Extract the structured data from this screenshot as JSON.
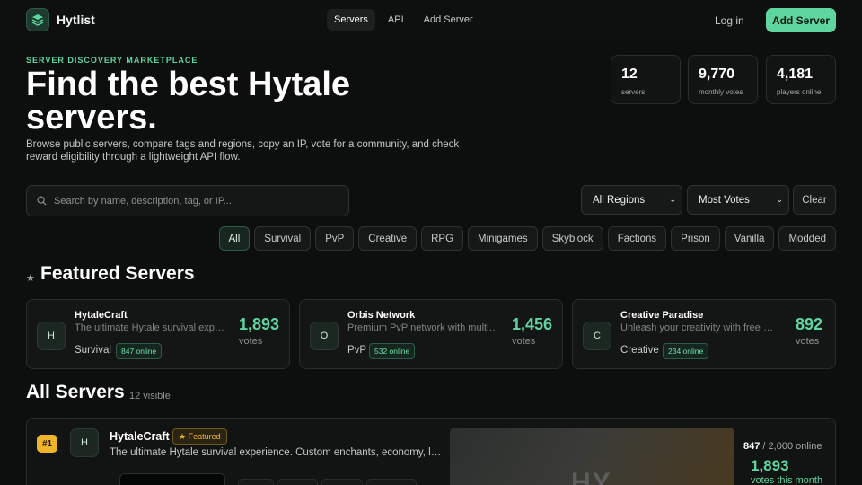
{
  "nav": {
    "brand": "Hytlist",
    "links": [
      "Servers",
      "API",
      "Add Server"
    ],
    "login": "Log in",
    "cta": "Add Server"
  },
  "hero": {
    "eyebrow": "SERVER DISCOVERY MARKETPLACE",
    "title": "Find the best Hytale servers.",
    "lead": "Browse public servers, compare tags and regions, copy an IP, vote for a community, and check reward eligibility through a lightweight API flow."
  },
  "stats": [
    {
      "value": "12",
      "label": "servers"
    },
    {
      "value": "9,770",
      "label": "monthly votes"
    },
    {
      "value": "4,181",
      "label": "players online"
    }
  ],
  "filters": {
    "search_placeholder": "Search by name, description, tag, or IP...",
    "region": "All Regions",
    "sort": "Most Votes",
    "clear": "Clear",
    "tags": [
      "All",
      "Survival",
      "PvP",
      "Creative",
      "RPG",
      "Minigames",
      "Skyblock",
      "Factions",
      "Prison",
      "Vanilla",
      "Modded"
    ]
  },
  "featured": {
    "title": "Featured Servers",
    "star": "★",
    "cards": [
      {
        "initial": "H",
        "name": "HytaleCraft",
        "desc": "The ultimate Hytale survival experience.",
        "type": "Survival",
        "online": "847 online",
        "votes": "1,893",
        "votes_label": "votes"
      },
      {
        "initial": "O",
        "name": "Orbis Network",
        "desc": "Premium PvP network with multiple game modes.",
        "type": "PvP",
        "online": "532 online",
        "votes": "1,456",
        "votes_label": "votes"
      },
      {
        "initial": "C",
        "name": "Creative Paradise",
        "desc": "Unleash your creativity with free plots.",
        "type": "Creative",
        "online": "234 online",
        "votes": "892",
        "votes_label": "votes"
      }
    ]
  },
  "all": {
    "title": "All Servers",
    "visible": "12 visible",
    "row": {
      "rank": "#1",
      "initial": "H",
      "name": "HytaleCraft",
      "badge": "★ Featured",
      "desc": "The ultimate Hytale survival experience. Custom enchants, economy, land claims and more.",
      "banner_text": "HY",
      "online_now": "847",
      "online_max": "/ 2,000 online",
      "votes": "1,893",
      "votes_label": "votes this month"
    }
  },
  "colors": {
    "accent": "#5fd6a0",
    "gold": "#f0b429",
    "background": "#0d0e0e"
  }
}
